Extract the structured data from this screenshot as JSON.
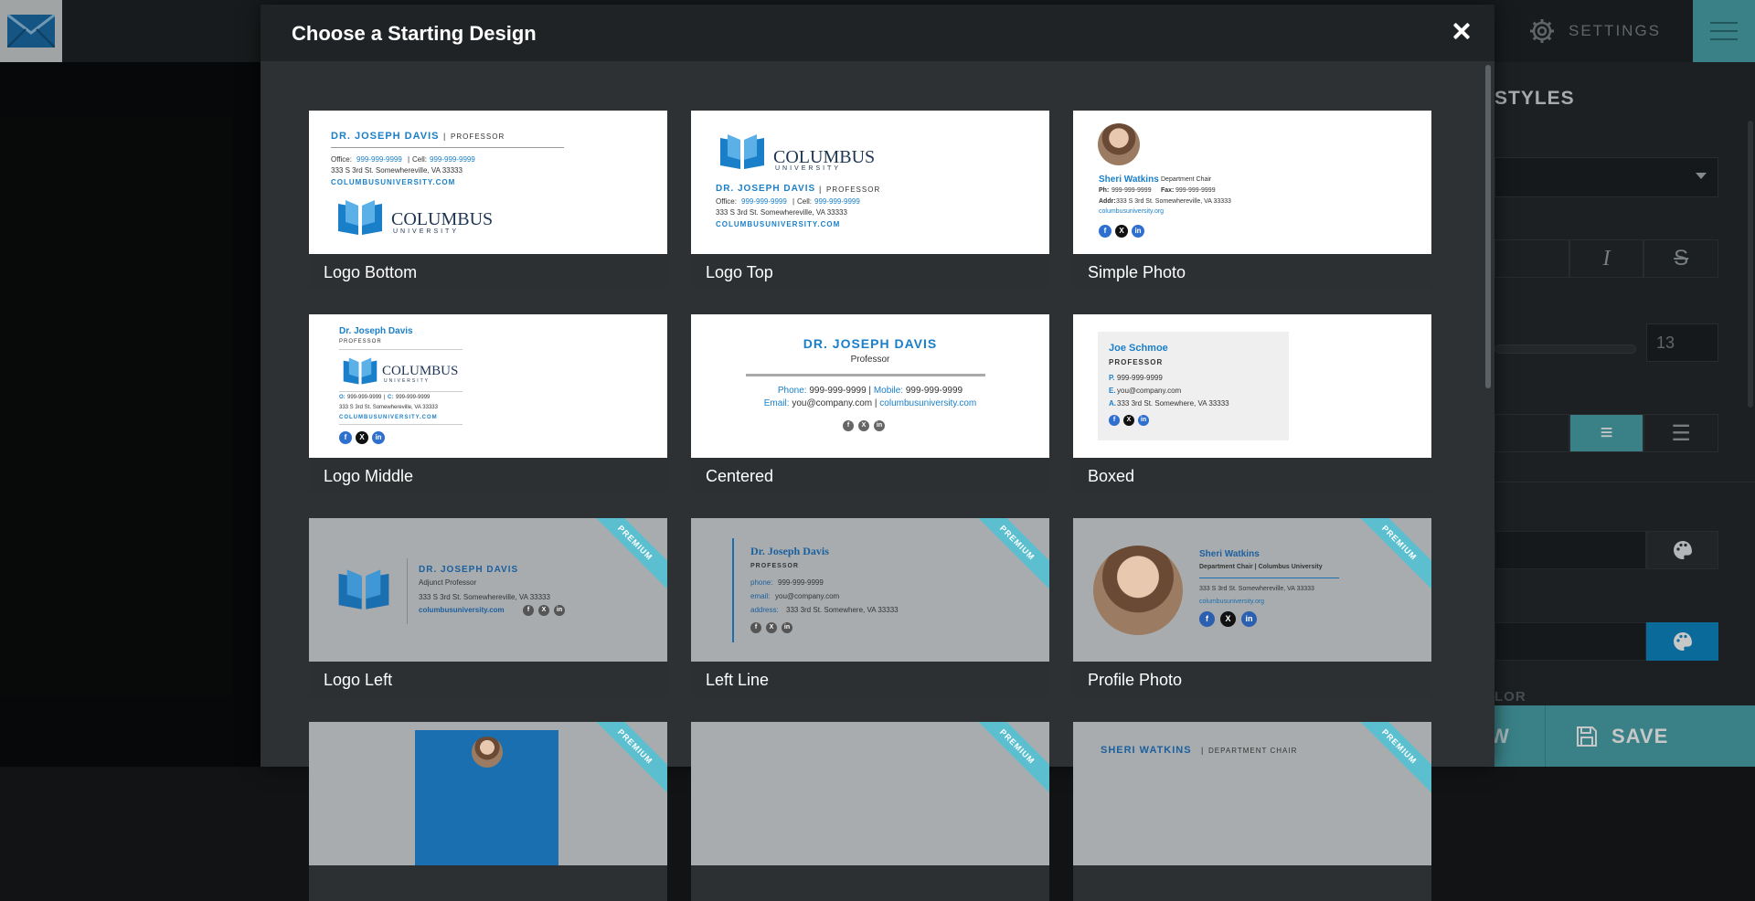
{
  "app": {
    "settings_label": "SETTINGS",
    "settings_fragment": "S",
    "right_panel_title": "STYLES",
    "font_size_value": "13",
    "color_label_fragment": "LOR",
    "preview_label_fragment": "W",
    "save_label": "SAVE",
    "accent_color": "#4aa4ad",
    "link_color": "#0d88c6"
  },
  "modal": {
    "title": "Choose a Starting Design",
    "premium_badge": "PREMIUM",
    "designs": [
      {
        "label": "Logo Bottom",
        "premium": false
      },
      {
        "label": "Logo Top",
        "premium": false
      },
      {
        "label": "Simple Photo",
        "premium": false
      },
      {
        "label": "Logo Middle",
        "premium": false
      },
      {
        "label": "Centered",
        "premium": false
      },
      {
        "label": "Boxed",
        "premium": false
      },
      {
        "label": "Logo Left",
        "premium": true
      },
      {
        "label": "Left Line",
        "premium": true
      },
      {
        "label": "Profile Photo",
        "premium": true
      },
      {
        "label": "",
        "premium": true
      },
      {
        "label": "",
        "premium": true
      },
      {
        "label": "",
        "premium": true
      }
    ]
  },
  "sig": {
    "name_caps": "DR. JOSEPH DAVIS",
    "sep": "|",
    "professor_caps": "PROFESSOR",
    "office_label": "Office:",
    "cell_label": "Cell:",
    "phone_num": "999-999-9999",
    "address": "333 S 3rd St. Somewhereville, VA 33333",
    "website_caps": "COLUMBUSUNIVERSITY.COM",
    "columbus": "COLUMBUS",
    "university": "UNIVERSITY",
    "sheri_name": "Sheri Watkins",
    "dept_chair": "Department Chair",
    "ph_label": "Ph:",
    "fax_label": "Fax:",
    "addr_label": "Addr:",
    "website": "columbusuniversity.org",
    "name_title": "Dr. Joseph Davis",
    "o_label": "O:",
    "c_label": "C:",
    "professor": "Professor",
    "phone_label": "Phone:",
    "mobile_label": "Mobile:",
    "email_label": "Email:",
    "email": "you@company.com",
    "website_com": "columbusuniversity.com",
    "joe_name": "Joe Schmoe",
    "p_label": "P.",
    "e_label": "E.",
    "a_label": "A.",
    "boxed_address": "333 3rd St. Somewhere, VA 33333",
    "adjunct": "Adjunct Professor",
    "phone_lower": "phone:",
    "email_lower": "email:",
    "address_lower": "address:",
    "leftline_address": "333 3rd St. Somewhere, VA 33333",
    "profile_dept": "Department Chair | Columbus University",
    "sheri_caps": "SHERI WATKINS",
    "dept_chair_caps": "DEPARTMENT CHAIR"
  }
}
